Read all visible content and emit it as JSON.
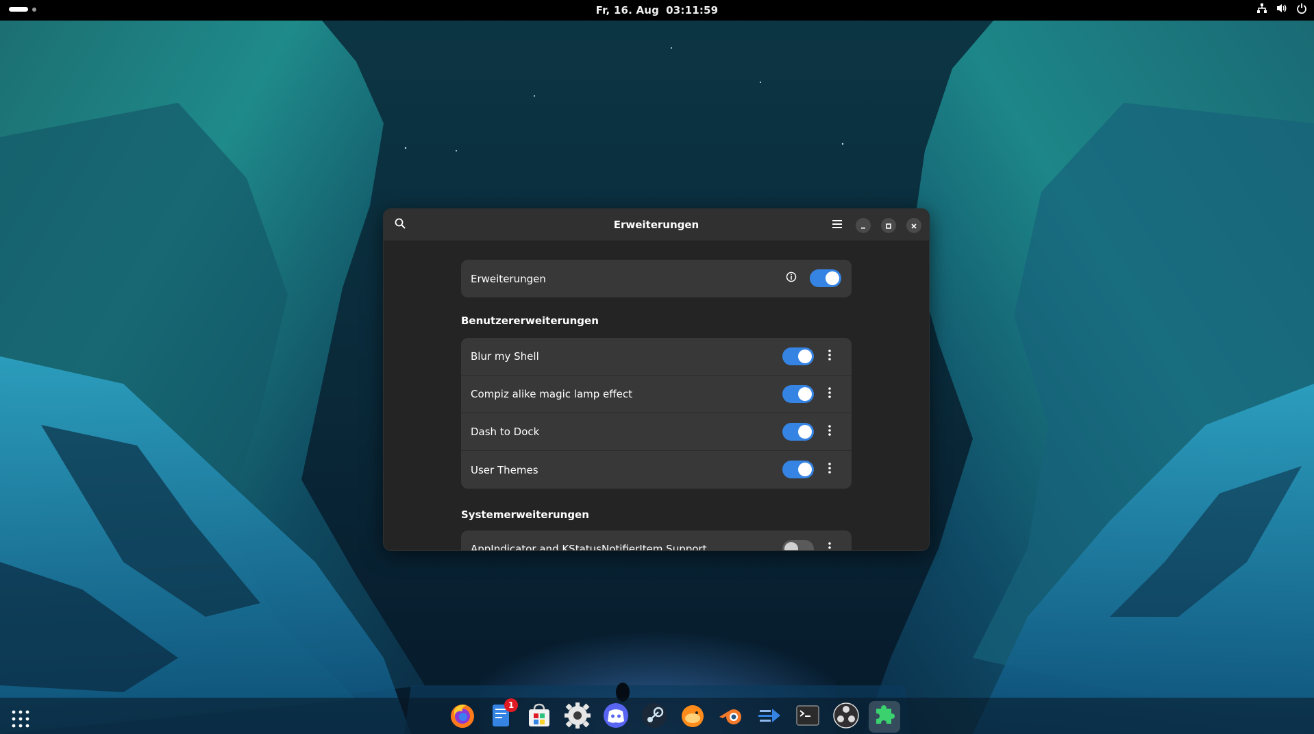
{
  "topbar": {
    "date": "Fr, 16. Aug",
    "time": "03:11:59"
  },
  "window": {
    "title": "Erweiterungen",
    "master_row": {
      "label": "Erweiterungen",
      "enabled": true
    },
    "sections": [
      {
        "title": "Benutzererweiterungen",
        "items": [
          {
            "label": "Blur my Shell",
            "enabled": true
          },
          {
            "label": "Compiz alike magic lamp effect",
            "enabled": true
          },
          {
            "label": "Dash to Dock",
            "enabled": true
          },
          {
            "label": "User Themes",
            "enabled": true
          }
        ]
      },
      {
        "title": "Systemerweiterungen",
        "items": [
          {
            "label": "AppIndicator and KStatusNotifierItem Support",
            "enabled": false
          }
        ]
      }
    ]
  },
  "dock": {
    "badge_count": "1",
    "apps": [
      "firefox-icon",
      "text-editor-icon",
      "software-store-icon",
      "settings-icon",
      "discord-icon",
      "steam-icon",
      "fish-app-icon",
      "blender-icon",
      "transfer-app-icon",
      "terminal-icon",
      "obs-icon",
      "extensions-icon"
    ]
  },
  "colors": {
    "accent": "#3584e4",
    "window_bg": "#242424",
    "headerbar_bg": "#303030",
    "row_bg": "#383838",
    "badge": "#e01b24"
  }
}
